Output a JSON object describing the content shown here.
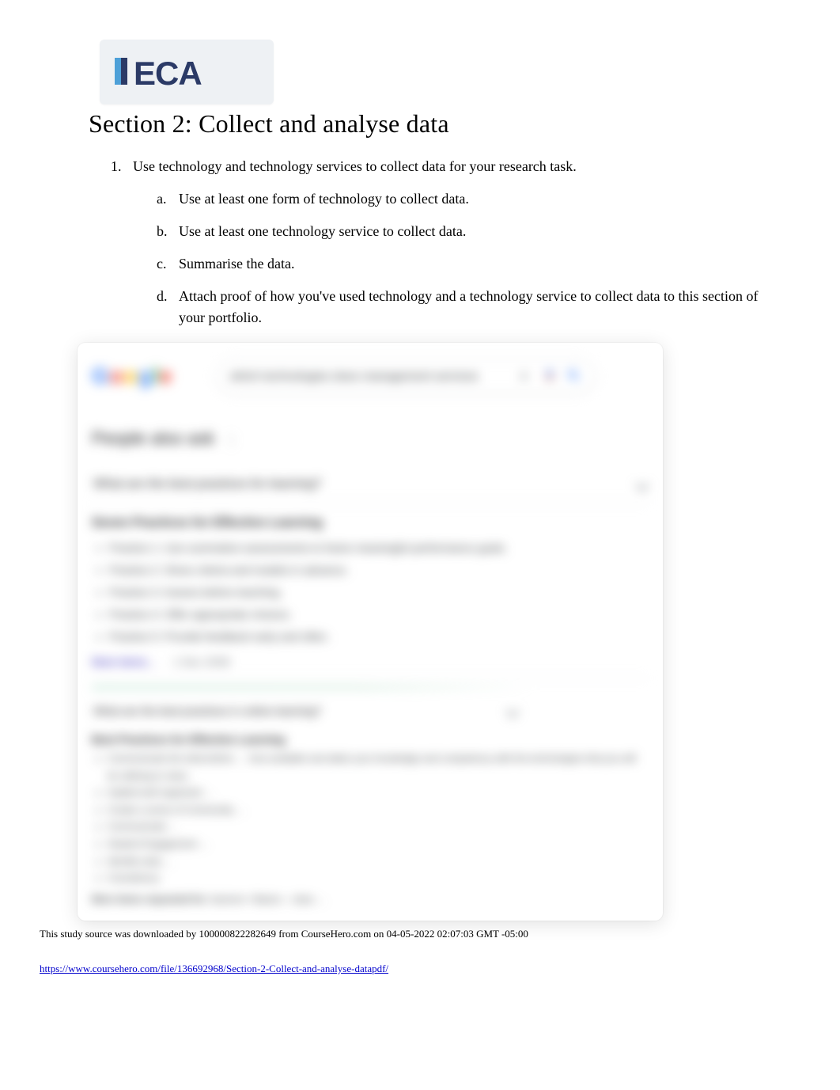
{
  "logo": {
    "text": "ECA"
  },
  "section_title": "Section 2: Collect and analyse data",
  "list": {
    "item1": {
      "num": "1.",
      "text": "Use technology and technology services to collect data for your research task.",
      "sub": {
        "a": {
          "num": "a.",
          "text": "Use at least one form of technology to collect data."
        },
        "b": {
          "num": "b.",
          "text": "Use at least one technology service to collect data."
        },
        "c": {
          "num": "c.",
          "text": "Summarise the data."
        },
        "d": {
          "num": "d.",
          "text": "Attach proof of how you've used technology and a technology service to collect data to this section of your portfolio."
        }
      }
    }
  },
  "embedded": {
    "search_query": "which technologies does management services",
    "paa_title": "People also ask",
    "q1": "What are the best practices for learning?",
    "snippet1_title": "Seven Practices for Effective Learning",
    "snippet1_items": [
      "Practice 1: Use summative assessments to frame meaningful performance goals.",
      "Practice 2: Show criteria and models in advance.",
      "Practice 3: Assess before teaching.",
      "Practice 4: Offer appropriate choices.",
      "Practice 5: Provide feedback early and often."
    ],
    "more_items": "More items...",
    "date1": "1 Dec 2008",
    "q2": "What are the best practices in online learning?",
    "snippet2_title": "Best Practices for Effective Learning",
    "snippet2_items": [
      "Communicate the what before … how available and attain your knowledge and competency with the technologies that you will be utilizing to class.",
      "Implied well organized … ",
      "Create a sense of Community … ",
      "Communicate … ",
      "Student Engagement … ",
      "Identify early … ",
      "Consistency"
    ],
    "more2_label": "More items requested for:",
    "more2_value": "learners • Basics – class …"
  },
  "footer": {
    "download_note": "This study source was downloaded by 100000822282649 from CourseHero.com on 04-05-2022 02:07:03 GMT -05:00",
    "url": "https://www.coursehero.com/file/136692968/Section-2-Collect-and-analyse-datapdf/"
  }
}
